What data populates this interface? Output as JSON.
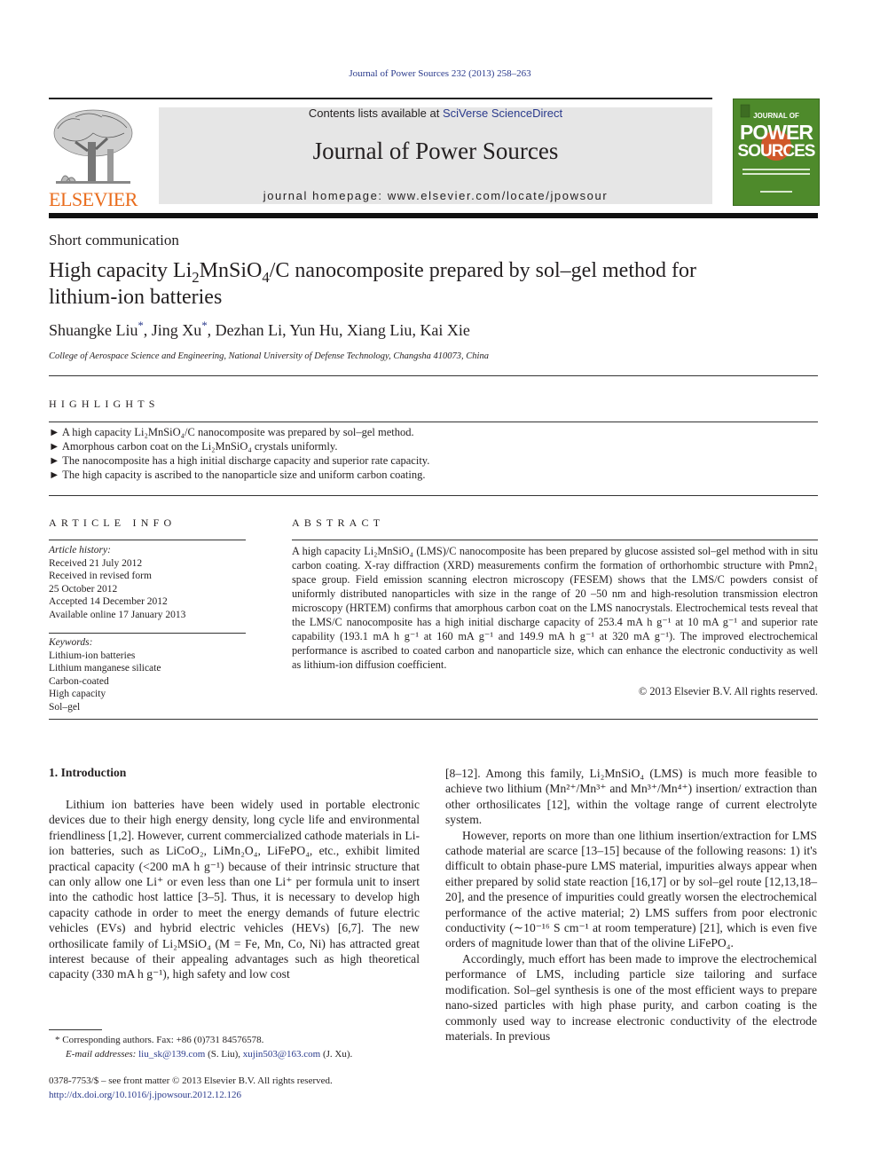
{
  "header": {
    "journal_ref": "Journal of Power Sources 232 (2013) 258–263",
    "contents_prefix": "Contents lists available at ",
    "contents_link": "SciVerse ScienceDirect",
    "journal_title": "Journal of Power Sources",
    "homepage": "journal homepage: www.elsevier.com/locate/jpowsour",
    "publisher_logo_text": "ELSEVIER",
    "cover": {
      "line1": "JOURNAL OF",
      "line2": "POWER",
      "line3": "SOURCES",
      "bg_color": "#4e8a2b",
      "accent_color": "#d0582a"
    }
  },
  "article": {
    "type": "Short communication",
    "title_parts": [
      "High capacity Li",
      "2",
      "MnSiO",
      "4",
      "/C nanocomposite prepared by sol–gel method for lithium-ion batteries"
    ],
    "authors": [
      {
        "name": "Shuangke Liu",
        "mark": "*"
      },
      {
        "name": "Jing Xu",
        "mark": "*"
      },
      {
        "name": "Dezhan Li",
        "mark": ""
      },
      {
        "name": "Yun Hu",
        "mark": ""
      },
      {
        "name": "Xiang Liu",
        "mark": ""
      },
      {
        "name": "Kai Xie",
        "mark": ""
      }
    ],
    "affiliation": "College of Aerospace Science and Engineering, National University of Defense Technology, Changsha 410073, China"
  },
  "highlights": {
    "heading": "HIGHLIGHTS",
    "bullet": "►",
    "items": [
      "A high capacity Li₂MnSiO₄/C nanocomposite was prepared by sol–gel method.",
      "Amorphous carbon coat on the Li₂MnSiO₄ crystals uniformly.",
      "The nanocomposite has a high initial discharge capacity and superior rate capacity.",
      "The high capacity is ascribed to the nanoparticle size and uniform carbon coating."
    ]
  },
  "article_info": {
    "heading": "ARTICLE INFO",
    "history_label": "Article history:",
    "history": [
      "Received 21 July 2012",
      "Received in revised form",
      "25 October 2012",
      "Accepted 14 December 2012",
      "Available online 17 January 2013"
    ],
    "keywords_label": "Keywords:",
    "keywords": [
      "Lithium-ion batteries",
      "Lithium manganese silicate",
      "Carbon-coated",
      "High capacity",
      "Sol–gel"
    ]
  },
  "abstract": {
    "heading": "ABSTRACT",
    "text": "A high capacity Li₂MnSiO₄ (LMS)/C nanocomposite has been prepared by glucose assisted sol–gel method with in situ carbon coating. X-ray diffraction (XRD) measurements confirm the formation of orthorhombic structure with Pmn2₁ space group. Field emission scanning electron microscopy (FESEM) shows that the LMS/C powders consist of uniformly distributed nanoparticles with size in the range of 20 –50 nm and high-resolution transmission electron microscopy (HRTEM) confirms that amorphous carbon coat on the LMS nanocrystals. Electrochemical tests reveal that the LMS/C nanocomposite has a high initial discharge capacity of 253.4 mA h g⁻¹ at 10 mA g⁻¹ and superior rate capability (193.1 mA h g⁻¹ at 160 mA g⁻¹ and 149.9 mA h g⁻¹ at 320 mA g⁻¹). The improved electrochemical performance is ascribed to coated carbon and nanoparticle size, which can enhance the electronic conductivity as well as lithium-ion diffusion coefficient.",
    "copyright": "© 2013 Elsevier B.V. All rights reserved."
  },
  "body": {
    "section_heading": "1. Introduction",
    "col1_p1": "Lithium ion batteries have been widely used in portable electronic devices due to their high energy density, long cycle life and environmental friendliness [1,2]. However, current commercialized cathode materials in Li-ion batteries, such as LiCoO₂, LiMn₂O₄, LiFePO₄, etc., exhibit limited practical capacity (<200 mA h g⁻¹) because of their intrinsic structure that can only allow one Li⁺ or even less than one Li⁺ per formula unit to insert into the cathodic host lattice [3–5]. Thus, it is necessary to develop high capacity cathode in order to meet the energy demands of future electric vehicles (EVs) and hybrid electric vehicles (HEVs) [6,7]. The new orthosilicate family of Li₂MSiO₄ (M = Fe, Mn, Co, Ni) has attracted great interest because of their appealing advantages such as high theoretical capacity (330 mA h g⁻¹), high safety and low cost",
    "col2_p1": "[8–12]. Among this family, Li₂MnSiO₄ (LMS) is much more feasible to achieve two lithium (Mn²⁺/Mn³⁺ and Mn³⁺/Mn⁴⁺) insertion/ extraction than other orthosilicates [12], within the voltage range of current electrolyte system.",
    "col2_p2": "However, reports on more than one lithium insertion/extraction for LMS cathode material are scarce [13–15] because of the following reasons: 1) it's difficult to obtain phase-pure LMS material, impurities always appear when either prepared by solid state reaction [16,17] or by sol–gel route [12,13,18–20], and the presence of impurities could greatly worsen the electrochemical performance of the active material; 2) LMS suffers from poor electronic conductivity (∼10⁻¹⁶ S cm⁻¹ at room temperature) [21], which is even five orders of magnitude lower than that of the olivine LiFePO₄.",
    "col2_p3": "Accordingly, much effort has been made to improve the electrochemical performance of LMS, including particle size tailoring and surface modification. Sol–gel synthesis is one of the most efficient ways to prepare nano-sized particles with high phase purity, and carbon coating is the commonly used way to increase electronic conductivity of the electrode materials. In previous"
  },
  "footnotes": {
    "corresponding": "* Corresponding authors. Fax: +86 (0)731 84576578.",
    "email_label": "E-mail addresses:",
    "email1": "liu_sk@139.com",
    "email1_owner": " (S. Liu), ",
    "email2": "xujin503@163.com",
    "email2_owner": " (J. Xu).",
    "front_matter": "0378-7753/$ – see front matter © 2013 Elsevier B.V. All rights reserved.",
    "doi": "http://dx.doi.org/10.1016/j.jpowsour.2012.12.126"
  }
}
